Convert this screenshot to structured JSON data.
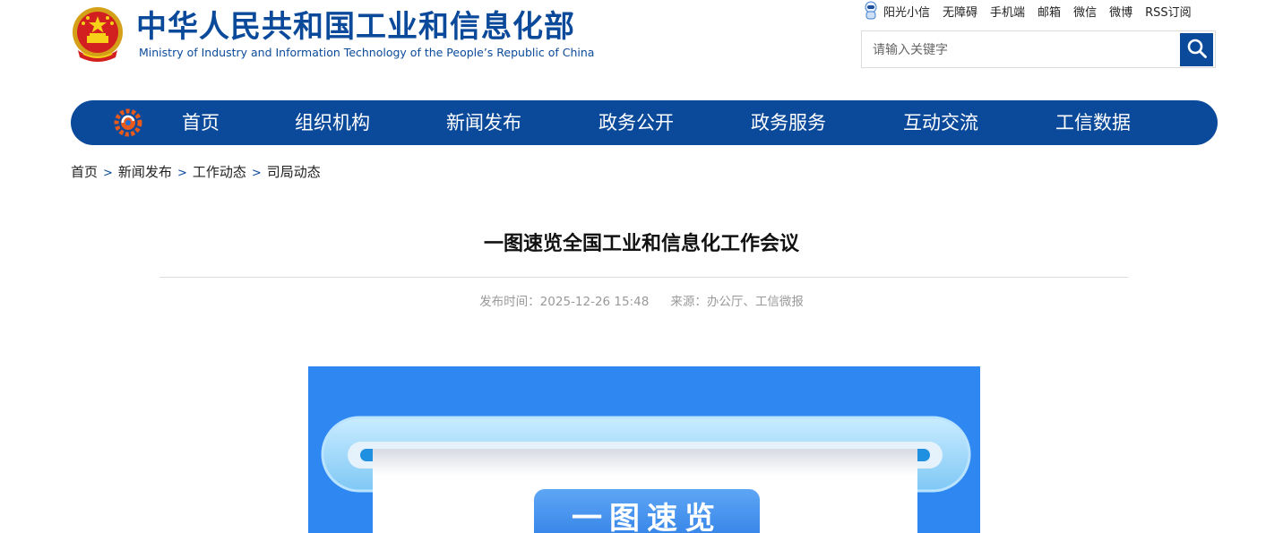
{
  "header": {
    "title_cn": "中华人民共和国工业和信息化部",
    "title_en": "Ministry of Industry and Information Technology of the People’s Republic of China",
    "top_links": [
      "阳光小信",
      "无障碍",
      "手机端",
      "邮箱",
      "微信",
      "微博",
      "RSS订阅"
    ],
    "search": {
      "placeholder": "请输入关键字",
      "value": ""
    }
  },
  "nav": {
    "items": [
      "首页",
      "组织机构",
      "新闻发布",
      "政务公开",
      "政务服务",
      "互动交流",
      "工信数据"
    ]
  },
  "breadcrumb": [
    "首页",
    "新闻发布",
    "工作动态",
    "司局动态"
  ],
  "article": {
    "title": "一图速览全国工业和信息化工作会议",
    "publish_label": "发布时间：",
    "publish_time": "2025-12-26 15:48",
    "source_label": "来源：",
    "source": "办公厅、工信微报",
    "banner_text": "一图速览"
  },
  "colors": {
    "brand_blue": "#0b4a9a",
    "infographic_bg": "#2f87f2",
    "meta_gray": "#999999"
  }
}
